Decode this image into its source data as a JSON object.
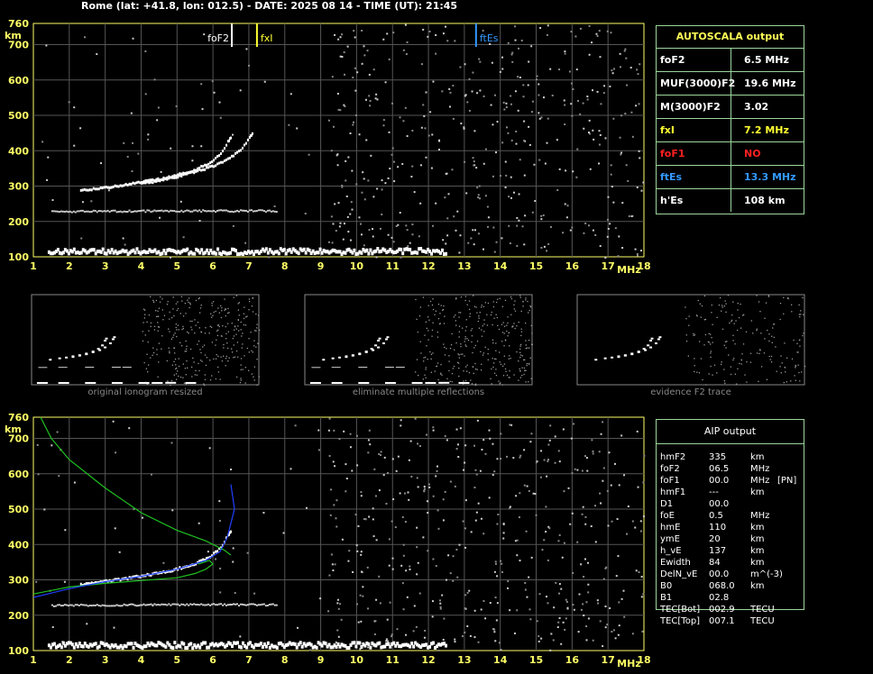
{
  "header": "Rome (lat: +41.8, lon: 012.5) - DATE: 2025 08 14 - TIME (UT): 21:45",
  "autoscala": {
    "title": "AUTOSCALA output",
    "rows": [
      {
        "key": "foF2",
        "value": "6.5 MHz",
        "color": "#ffffff"
      },
      {
        "key": "MUF(3000)F2",
        "value": "19.6 MHz",
        "color": "#ffffff"
      },
      {
        "key": "M(3000)F2",
        "value": "3.02",
        "color": "#ffffff"
      },
      {
        "key": "fxI",
        "value": "7.2 MHz",
        "color": "#ffff33"
      },
      {
        "key": "foF1",
        "value": "NO",
        "color": "#ff2020"
      },
      {
        "key": "ftEs",
        "value": "13.3 MHz",
        "color": "#3399ff"
      },
      {
        "key": "h'Es",
        "value": "108    km",
        "color": "#ffffff"
      }
    ]
  },
  "aip": {
    "title": "AIP output",
    "rows": [
      [
        "hmF2",
        "335",
        "km",
        ""
      ],
      [
        "foF2",
        "06.5",
        "MHz",
        ""
      ],
      [
        "foF1",
        "00.0",
        "MHz",
        "[PN]"
      ],
      [
        "hmF1",
        "---",
        "km",
        ""
      ],
      [
        "D1",
        "00.0",
        "",
        ""
      ],
      [
        "foE",
        "0.5",
        "MHz",
        ""
      ],
      [
        "hmE",
        "110",
        "km",
        ""
      ],
      [
        "ymE",
        "20",
        "km",
        ""
      ],
      [
        "h_vE",
        "137",
        "km",
        ""
      ],
      [
        "Ewidth",
        "84",
        "km",
        ""
      ],
      [
        "DelN_vE",
        "00.0",
        "m^(-3)",
        ""
      ],
      [
        "B0",
        "068.0",
        "km",
        ""
      ],
      [
        "B1",
        "02.8",
        "",
        ""
      ],
      [
        "TEC[Bot]",
        "002.9",
        "TECU",
        ""
      ],
      [
        "TEC[Top]",
        "007.1",
        "TECU",
        ""
      ]
    ]
  },
  "thumbnails": [
    "original ionogram resized",
    "eliminate multiple reflections",
    "evidence F2 trace"
  ],
  "chart_data": [
    {
      "type": "scatter",
      "title": "",
      "xlabel": "MHz",
      "ylabel": "km",
      "xlim": [
        1,
        18
      ],
      "ylim": [
        100,
        760
      ],
      "x_ticks": [
        1,
        2,
        3,
        4,
        5,
        6,
        7,
        8,
        9,
        10,
        11,
        12,
        13,
        14,
        15,
        16,
        17,
        18
      ],
      "y_ticks": [
        100,
        200,
        300,
        400,
        500,
        600,
        700,
        760
      ],
      "markers": [
        {
          "label": "foF2",
          "x": 6.5,
          "color": "#ffffff"
        },
        {
          "label": "fxI",
          "x": 7.2,
          "color": "#ffff33"
        },
        {
          "label": "ftEs",
          "x": 13.3,
          "color": "#3399ff"
        }
      ],
      "traces": {
        "F2_o": [
          [
            2.3,
            290
          ],
          [
            3,
            300
          ],
          [
            3.5,
            306
          ],
          [
            4,
            315
          ],
          [
            4.5,
            323
          ],
          [
            5,
            335
          ],
          [
            5.5,
            350
          ],
          [
            5.9,
            370
          ],
          [
            6.2,
            395
          ],
          [
            6.4,
            430
          ],
          [
            6.5,
            445
          ]
        ],
        "F2_x": [
          [
            4,
            310
          ],
          [
            4.5,
            320
          ],
          [
            5,
            330
          ],
          [
            5.5,
            345
          ],
          [
            6,
            360
          ],
          [
            6.4,
            380
          ],
          [
            6.8,
            410
          ],
          [
            7,
            440
          ],
          [
            7.1,
            455
          ]
        ],
        "Es": [
          [
            1.4,
            120
          ],
          [
            3,
            120
          ],
          [
            5,
            120
          ],
          [
            7,
            120
          ],
          [
            9,
            120
          ],
          [
            10,
            120
          ],
          [
            11,
            121
          ],
          [
            12.5,
            120
          ]
        ],
        "Es2": [
          [
            1.5,
            230
          ],
          [
            3,
            231
          ],
          [
            5,
            232
          ],
          [
            7,
            232
          ],
          [
            7.8,
            232
          ]
        ]
      }
    },
    {
      "type": "line",
      "title": "",
      "xlabel": "MHz",
      "ylabel": "km",
      "xlim": [
        1,
        18
      ],
      "ylim": [
        100,
        760
      ],
      "series": [
        {
          "color": "#20c020",
          "values": [
            [
              1.2,
              760
            ],
            [
              1.5,
              700
            ],
            [
              2,
              640
            ],
            [
              3,
              560
            ],
            [
              4,
              490
            ],
            [
              5,
              440
            ],
            [
              5.8,
              410
            ],
            [
              6.3,
              385
            ],
            [
              6.5,
              370
            ]
          ]
        },
        {
          "color": "#20c020",
          "values": [
            [
              1,
              260
            ],
            [
              1.5,
              270
            ],
            [
              2,
              280
            ],
            [
              3,
              290
            ],
            [
              4,
              298
            ],
            [
              5,
              306
            ],
            [
              5.5,
              318
            ],
            [
              5.8,
              330
            ],
            [
              6,
              345
            ],
            [
              5.9,
              355
            ],
            [
              5.6,
              345
            ]
          ]
        },
        {
          "color": "#2040ff",
          "values": [
            [
              1,
              250
            ],
            [
              2,
              275
            ],
            [
              3,
              295
            ],
            [
              4,
              310
            ],
            [
              5,
              330
            ],
            [
              5.8,
              355
            ],
            [
              6.2,
              380
            ],
            [
              6.4,
              420
            ],
            [
              6.5,
              460
            ],
            [
              6.6,
              500
            ],
            [
              6.5,
              570
            ]
          ]
        }
      ],
      "traces": {
        "F2_o": [
          [
            2.3,
            290
          ],
          [
            3,
            300
          ],
          [
            3.5,
            306
          ],
          [
            4,
            315
          ],
          [
            4.5,
            323
          ],
          [
            5,
            335
          ],
          [
            5.5,
            350
          ],
          [
            5.9,
            370
          ],
          [
            6.2,
            395
          ],
          [
            6.4,
            430
          ],
          [
            6.5,
            445
          ]
        ],
        "Es": [
          [
            1.4,
            120
          ],
          [
            3,
            120
          ],
          [
            5,
            120
          ],
          [
            7,
            120
          ],
          [
            9,
            120
          ],
          [
            10,
            120
          ],
          [
            11,
            121
          ],
          [
            12.5,
            120
          ]
        ],
        "Es2": [
          [
            1.5,
            230
          ],
          [
            3,
            231
          ],
          [
            5,
            232
          ],
          [
            7,
            232
          ],
          [
            7.8,
            232
          ]
        ]
      }
    }
  ]
}
